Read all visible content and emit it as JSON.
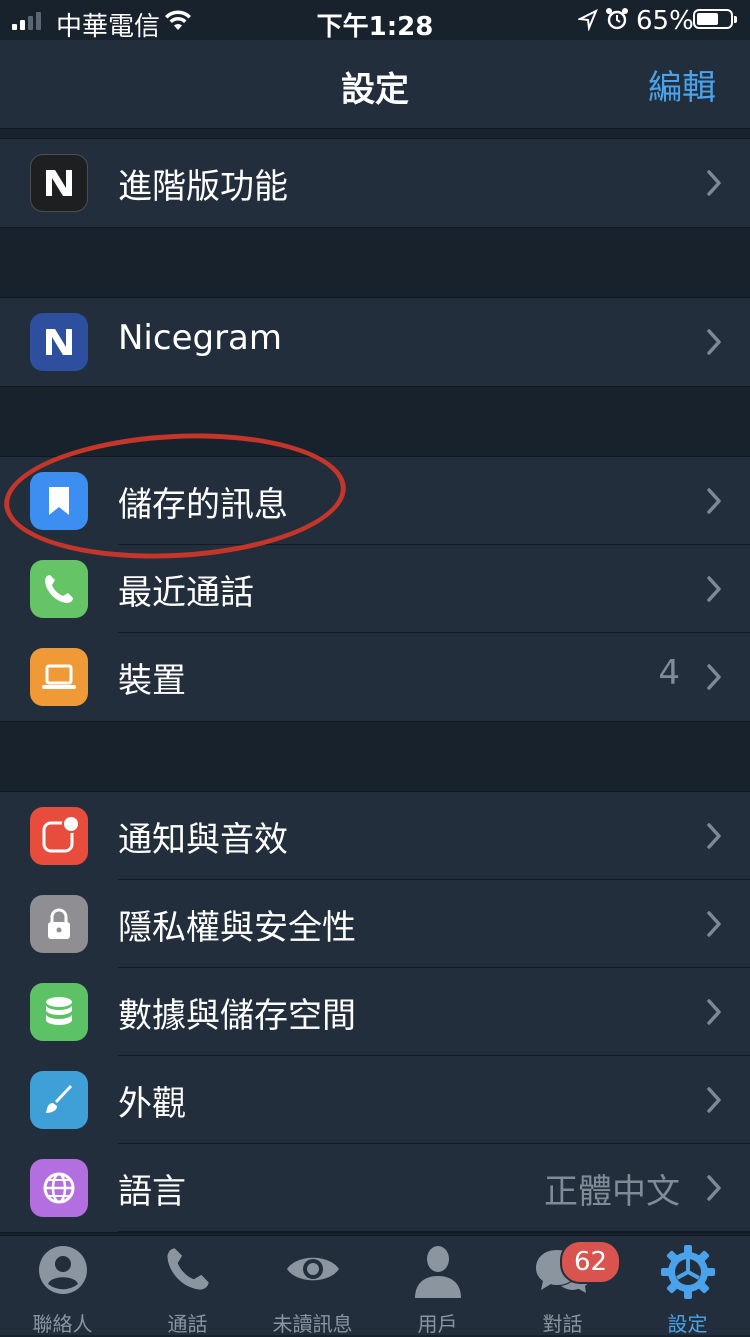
{
  "status_bar": {
    "carrier": "中華電信",
    "time": "下午1:28",
    "battery_percent": "65%",
    "battery_level": 0.65
  },
  "nav": {
    "title": "設定",
    "edit_label": "編輯"
  },
  "groups": [
    {
      "rows": [
        {
          "label": "進階版功能",
          "icon": "nicegram-premium-icon",
          "icon_color": "#1e1f21"
        }
      ]
    },
    {
      "rows": [
        {
          "label": "Nicegram",
          "icon": "nicegram-icon",
          "icon_color": "#2e4f9e"
        }
      ]
    },
    {
      "rows": [
        {
          "label": "儲存的訊息",
          "icon": "bookmark-icon",
          "icon_color": "#3c8ff0"
        },
        {
          "label": "最近通話",
          "icon": "phone-icon",
          "icon_color": "#65c466"
        },
        {
          "label": "裝置",
          "icon": "laptop-icon",
          "icon_color": "#f09a37",
          "value": "4"
        }
      ]
    },
    {
      "rows": [
        {
          "label": "通知與音效",
          "icon": "notification-icon",
          "icon_color": "#e74c3c"
        },
        {
          "label": "隱私權與安全性",
          "icon": "lock-icon",
          "icon_color": "#8e8e93"
        },
        {
          "label": "數據與儲存空間",
          "icon": "database-icon",
          "icon_color": "#5cc265"
        },
        {
          "label": "外觀",
          "icon": "brush-icon",
          "icon_color": "#3fa0d8"
        },
        {
          "label": "語言",
          "icon": "globe-icon",
          "icon_color": "#b36ee0",
          "value": "正體中文"
        }
      ]
    }
  ],
  "tabs": [
    {
      "label": "聯絡人",
      "icon": "contact-icon"
    },
    {
      "label": "通話",
      "icon": "phone-tab-icon"
    },
    {
      "label": "未讀訊息",
      "icon": "eye-icon"
    },
    {
      "label": "用戶",
      "icon": "user-icon"
    },
    {
      "label": "對話",
      "icon": "chats-icon",
      "badge": "62"
    },
    {
      "label": "設定",
      "icon": "settings-gear-icon",
      "active": true
    }
  ],
  "colors": {
    "background": "#18222d",
    "cell": "#222e3c",
    "accent": "#4aa3ea",
    "highlight_circle": "#c4352a"
  }
}
